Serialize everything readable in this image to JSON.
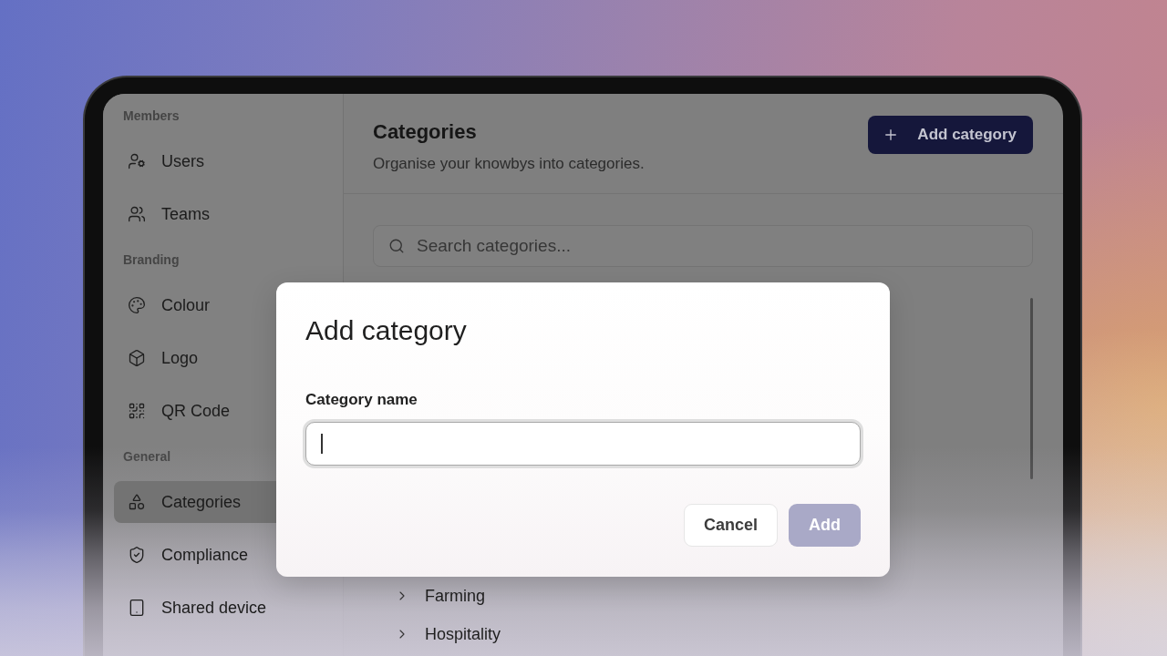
{
  "sidebar": {
    "sections": [
      {
        "label": "Members",
        "items": [
          {
            "label": "Users",
            "selected": false
          },
          {
            "label": "Teams",
            "selected": false
          }
        ]
      },
      {
        "label": "Branding",
        "items": [
          {
            "label": "Colour",
            "selected": false
          },
          {
            "label": "Logo",
            "selected": false
          },
          {
            "label": "QR Code",
            "selected": false
          }
        ]
      },
      {
        "label": "General",
        "items": [
          {
            "label": "Categories",
            "selected": true
          },
          {
            "label": "Compliance",
            "selected": false
          },
          {
            "label": "Shared device",
            "selected": false
          }
        ]
      }
    ]
  },
  "header": {
    "title": "Categories",
    "subtitle": "Organise your knowbys into categories.",
    "add_button": "Add category"
  },
  "search": {
    "placeholder": "Search categories..."
  },
  "categories": [
    {
      "name": "Farming"
    },
    {
      "name": "Hospitality"
    }
  ],
  "dialog": {
    "title": "Add category",
    "field": {
      "label": "Category name",
      "focused": true
    },
    "buttons": [
      {
        "label": "Cancel",
        "kind": "secondary",
        "disabled": false
      },
      {
        "label": "Add",
        "kind": "primary",
        "disabled": true
      }
    ]
  }
}
